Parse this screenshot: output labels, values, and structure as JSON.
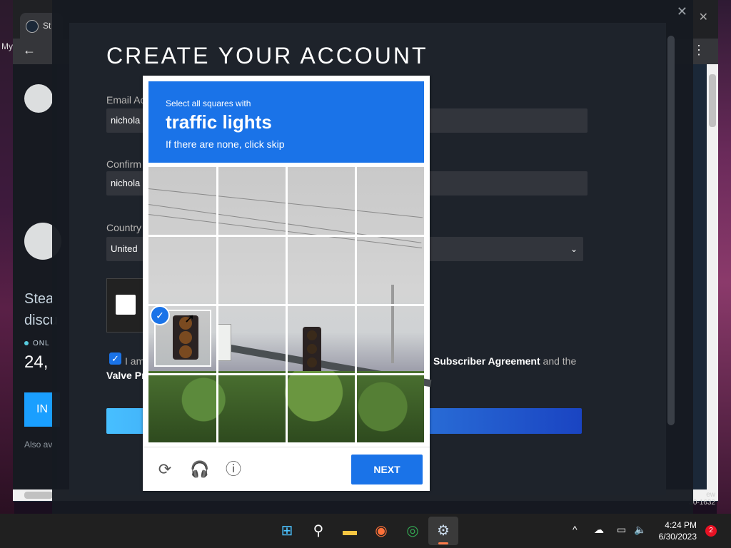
{
  "browser": {
    "tab_label": "St",
    "bookmark_label": "My"
  },
  "steam_page": {
    "intro_text_1": "Stea",
    "intro_text_2": "discu",
    "online_label": "ONL",
    "online_count": "24,",
    "install_button_label": "IN",
    "also_label": "Also av",
    "corner_text_1": "ew",
    "corner_text_2": "30-1632"
  },
  "signup": {
    "title": "CREATE YOUR ACCOUNT",
    "email_label": "Email Ac",
    "email_value": "nichola",
    "confirm_label": "Confirm",
    "confirm_value": "nichola",
    "country_label": "Country",
    "country_value": "United",
    "agree_prefix": "I am",
    "agree_link": "Subscriber Agreement",
    "agree_suffix": " and the",
    "valve_link": "Valve Pr"
  },
  "captcha": {
    "instruction": "Select all squares with",
    "target": "traffic lights",
    "hint": "If there are none, click skip",
    "next_label": "NEXT",
    "selected_tiles": [
      8
    ]
  },
  "taskbar": {
    "time": "4:24 PM",
    "date": "6/30/2023",
    "notification_count": "2"
  },
  "colors": {
    "captcha_blue": "#1a73e8",
    "steam_bg": "#1b2838",
    "taskbar": "#202020"
  }
}
